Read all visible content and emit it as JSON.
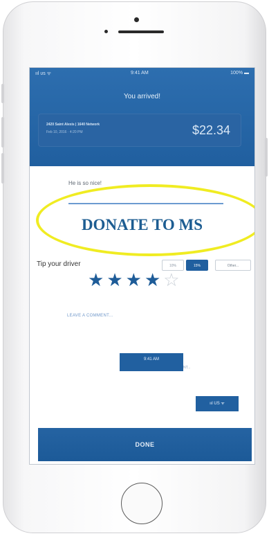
{
  "status_bar": {
    "carrier": "ııl ᴜs ᯤ",
    "time": "9:41 AM",
    "battery": "100% ▬"
  },
  "trip": {
    "title": "You arrived!",
    "route": "2420 Saint Alexis  |  1640 Network",
    "date": "Feb 10, 2016 · 4:20 PM",
    "amount": "$22.34"
  },
  "feedback": {
    "hint": "He is so nice!",
    "donate_label": "DONATE TO MS"
  },
  "tip": {
    "label": "Tip your driver",
    "options": [
      "10%",
      "15%",
      "Other..."
    ],
    "selected": "15%",
    "rating": 4,
    "rating_max": 5
  },
  "comment": {
    "label": "LEAVE A COMMENT..."
  },
  "overlays": {
    "time_box": "9:41 AM",
    "time_box_tail": "NT...",
    "signal_box": "ııl US ᯤ"
  },
  "footer": {
    "done_label": "DONE"
  },
  "colors": {
    "header_blue": "#2d6eaf",
    "button_blue": "#1e5c98",
    "highlight_yellow": "#f0ec22"
  }
}
